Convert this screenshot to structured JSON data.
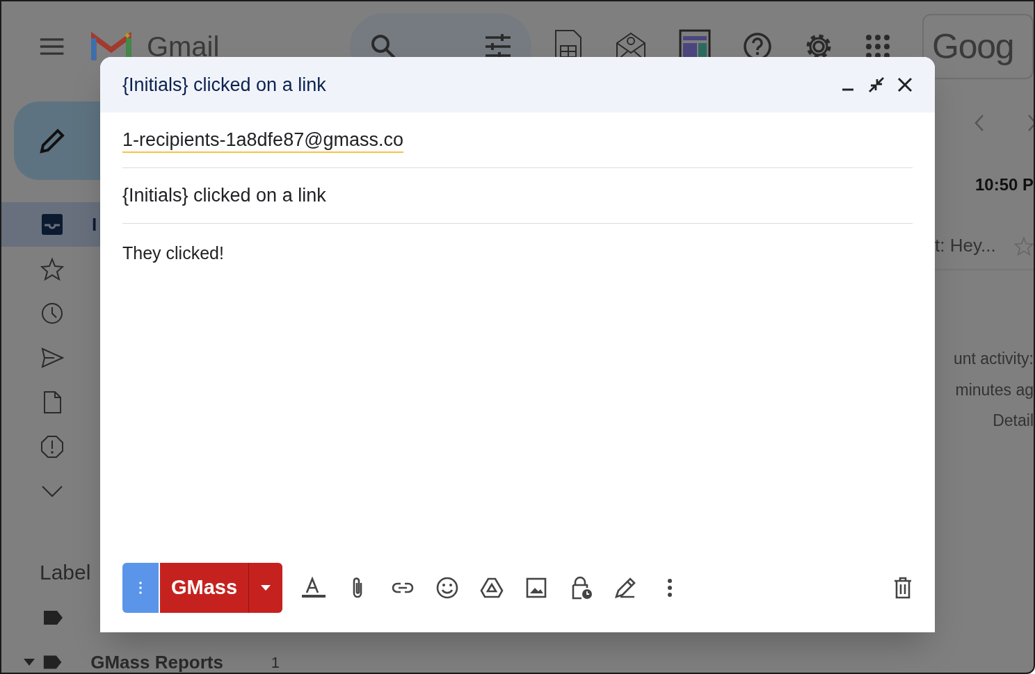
{
  "topbar": {
    "logo_text": "Gmail",
    "account_logo_text": "Goog"
  },
  "sidebar": {
    "items": [
      {
        "label": "I",
        "selected": true,
        "unread": true
      },
      {
        "selected": false
      },
      {
        "selected": false
      },
      {
        "selected": false
      },
      {
        "selected": false
      },
      {
        "selected": false
      },
      {
        "selected": false
      }
    ],
    "labels_heading": "Label",
    "labels": [
      {
        "kind": "tag"
      },
      {
        "kind": "tag",
        "label": "GMass Reports",
        "count": "1"
      }
    ]
  },
  "message_list": {
    "time": "10:50 P",
    "snippet": "t: Hey...",
    "starred": false,
    "activity": [
      "unt activity:",
      "minutes ag",
      "Detail"
    ]
  },
  "compose": {
    "title": "{Initials} clicked on a link",
    "to": "1-recipients-1a8dfe87@gmass.co",
    "subject": "{Initials} clicked on a link",
    "body": "They clicked!",
    "send_label": "GMass"
  }
}
